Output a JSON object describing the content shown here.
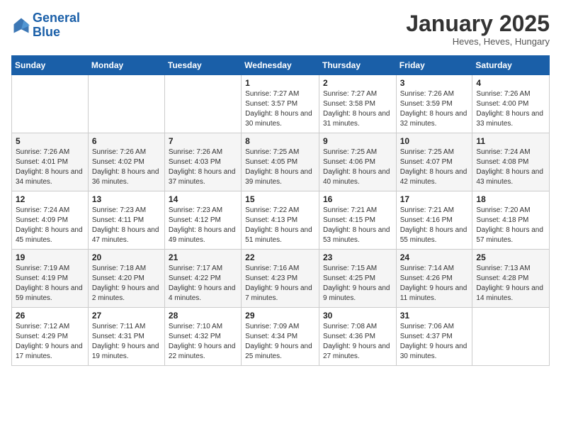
{
  "header": {
    "logo_line1": "General",
    "logo_line2": "Blue",
    "month": "January 2025",
    "location": "Heves, Heves, Hungary"
  },
  "weekdays": [
    "Sunday",
    "Monday",
    "Tuesday",
    "Wednesday",
    "Thursday",
    "Friday",
    "Saturday"
  ],
  "weeks": [
    [
      {
        "num": "",
        "info": ""
      },
      {
        "num": "",
        "info": ""
      },
      {
        "num": "",
        "info": ""
      },
      {
        "num": "1",
        "info": "Sunrise: 7:27 AM\nSunset: 3:57 PM\nDaylight: 8 hours\nand 30 minutes."
      },
      {
        "num": "2",
        "info": "Sunrise: 7:27 AM\nSunset: 3:58 PM\nDaylight: 8 hours\nand 31 minutes."
      },
      {
        "num": "3",
        "info": "Sunrise: 7:26 AM\nSunset: 3:59 PM\nDaylight: 8 hours\nand 32 minutes."
      },
      {
        "num": "4",
        "info": "Sunrise: 7:26 AM\nSunset: 4:00 PM\nDaylight: 8 hours\nand 33 minutes."
      }
    ],
    [
      {
        "num": "5",
        "info": "Sunrise: 7:26 AM\nSunset: 4:01 PM\nDaylight: 8 hours\nand 34 minutes."
      },
      {
        "num": "6",
        "info": "Sunrise: 7:26 AM\nSunset: 4:02 PM\nDaylight: 8 hours\nand 36 minutes."
      },
      {
        "num": "7",
        "info": "Sunrise: 7:26 AM\nSunset: 4:03 PM\nDaylight: 8 hours\nand 37 minutes."
      },
      {
        "num": "8",
        "info": "Sunrise: 7:25 AM\nSunset: 4:05 PM\nDaylight: 8 hours\nand 39 minutes."
      },
      {
        "num": "9",
        "info": "Sunrise: 7:25 AM\nSunset: 4:06 PM\nDaylight: 8 hours\nand 40 minutes."
      },
      {
        "num": "10",
        "info": "Sunrise: 7:25 AM\nSunset: 4:07 PM\nDaylight: 8 hours\nand 42 minutes."
      },
      {
        "num": "11",
        "info": "Sunrise: 7:24 AM\nSunset: 4:08 PM\nDaylight: 8 hours\nand 43 minutes."
      }
    ],
    [
      {
        "num": "12",
        "info": "Sunrise: 7:24 AM\nSunset: 4:09 PM\nDaylight: 8 hours\nand 45 minutes."
      },
      {
        "num": "13",
        "info": "Sunrise: 7:23 AM\nSunset: 4:11 PM\nDaylight: 8 hours\nand 47 minutes."
      },
      {
        "num": "14",
        "info": "Sunrise: 7:23 AM\nSunset: 4:12 PM\nDaylight: 8 hours\nand 49 minutes."
      },
      {
        "num": "15",
        "info": "Sunrise: 7:22 AM\nSunset: 4:13 PM\nDaylight: 8 hours\nand 51 minutes."
      },
      {
        "num": "16",
        "info": "Sunrise: 7:21 AM\nSunset: 4:15 PM\nDaylight: 8 hours\nand 53 minutes."
      },
      {
        "num": "17",
        "info": "Sunrise: 7:21 AM\nSunset: 4:16 PM\nDaylight: 8 hours\nand 55 minutes."
      },
      {
        "num": "18",
        "info": "Sunrise: 7:20 AM\nSunset: 4:18 PM\nDaylight: 8 hours\nand 57 minutes."
      }
    ],
    [
      {
        "num": "19",
        "info": "Sunrise: 7:19 AM\nSunset: 4:19 PM\nDaylight: 8 hours\nand 59 minutes."
      },
      {
        "num": "20",
        "info": "Sunrise: 7:18 AM\nSunset: 4:20 PM\nDaylight: 9 hours\nand 2 minutes."
      },
      {
        "num": "21",
        "info": "Sunrise: 7:17 AM\nSunset: 4:22 PM\nDaylight: 9 hours\nand 4 minutes."
      },
      {
        "num": "22",
        "info": "Sunrise: 7:16 AM\nSunset: 4:23 PM\nDaylight: 9 hours\nand 7 minutes."
      },
      {
        "num": "23",
        "info": "Sunrise: 7:15 AM\nSunset: 4:25 PM\nDaylight: 9 hours\nand 9 minutes."
      },
      {
        "num": "24",
        "info": "Sunrise: 7:14 AM\nSunset: 4:26 PM\nDaylight: 9 hours\nand 11 minutes."
      },
      {
        "num": "25",
        "info": "Sunrise: 7:13 AM\nSunset: 4:28 PM\nDaylight: 9 hours\nand 14 minutes."
      }
    ],
    [
      {
        "num": "26",
        "info": "Sunrise: 7:12 AM\nSunset: 4:29 PM\nDaylight: 9 hours\nand 17 minutes."
      },
      {
        "num": "27",
        "info": "Sunrise: 7:11 AM\nSunset: 4:31 PM\nDaylight: 9 hours\nand 19 minutes."
      },
      {
        "num": "28",
        "info": "Sunrise: 7:10 AM\nSunset: 4:32 PM\nDaylight: 9 hours\nand 22 minutes."
      },
      {
        "num": "29",
        "info": "Sunrise: 7:09 AM\nSunset: 4:34 PM\nDaylight: 9 hours\nand 25 minutes."
      },
      {
        "num": "30",
        "info": "Sunrise: 7:08 AM\nSunset: 4:36 PM\nDaylight: 9 hours\nand 27 minutes."
      },
      {
        "num": "31",
        "info": "Sunrise: 7:06 AM\nSunset: 4:37 PM\nDaylight: 9 hours\nand 30 minutes."
      },
      {
        "num": "",
        "info": ""
      }
    ]
  ]
}
